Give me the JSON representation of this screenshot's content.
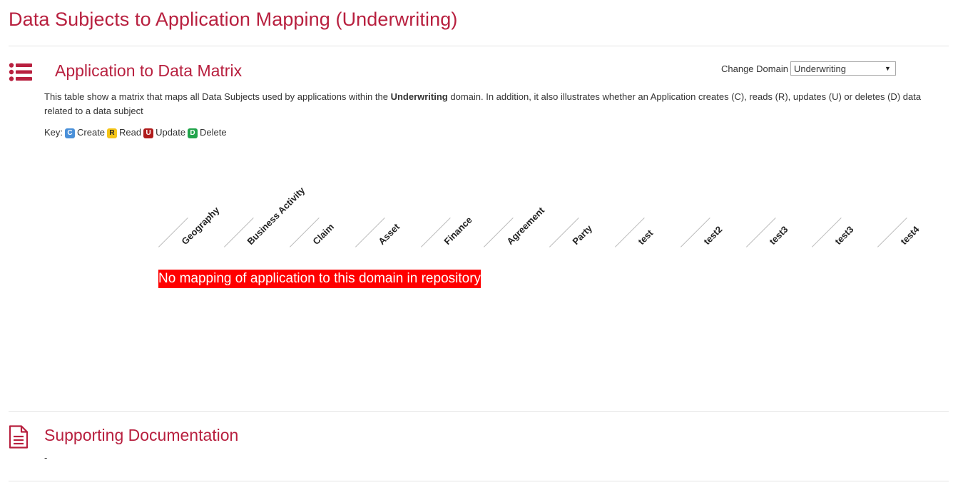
{
  "page": {
    "title": "Data Subjects to Application Mapping (Underwriting)"
  },
  "matrix_section": {
    "title": "Application to Data Matrix",
    "icon": "list-icon",
    "change_domain_label": "Change Domain",
    "selected_domain": "Underwriting",
    "description_before": "This table show a matrix that maps all Data Subjects used by applications within the ",
    "description_domain": "Underwriting",
    "description_after": " domain. In addition, it also illustrates whether an Application creates (C), reads (R), updates (U) or deletes (D) data related to a data subject",
    "key_label": "Key:",
    "key_items": [
      {
        "letter": "C",
        "label": "Create",
        "color": "#4a90d9",
        "text_color": "#ffffff"
      },
      {
        "letter": "R",
        "label": "Read",
        "color": "#f5c518",
        "text_color": "#222222"
      },
      {
        "letter": "U",
        "label": "Update",
        "color": "#b01c1c",
        "text_color": "#ffffff"
      },
      {
        "letter": "D",
        "label": "Delete",
        "color": "#21a44b",
        "text_color": "#ffffff"
      }
    ],
    "columns": [
      "Geography",
      "Business Activity",
      "Claim",
      "Asset",
      "Finance",
      "Agreement",
      "Party",
      "test",
      "test2",
      "test3",
      "test3",
      "test4"
    ],
    "no_mapping_message": "No mapping of application to this domain in repository"
  },
  "documentation_section": {
    "title": "Supporting Documentation",
    "icon": "document-icon",
    "content": "-"
  },
  "colors": {
    "accent": "#b8203f",
    "alert_bg": "#ff0000"
  }
}
